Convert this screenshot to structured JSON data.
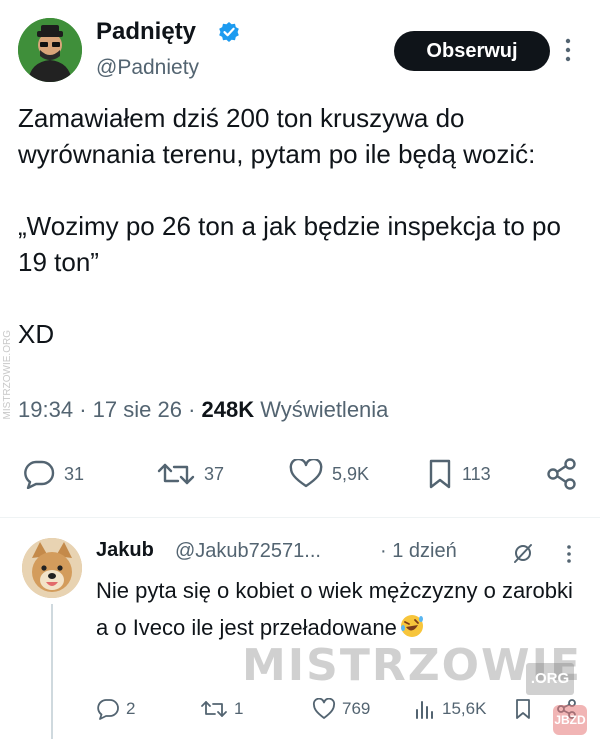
{
  "post": {
    "author_name": "Padnięty",
    "author_handle": "@Padniety",
    "follow_label": "Obserwuj",
    "text": "Zamawiałem dziś 200 ton kruszywa do wyrównania terenu, pytam po ile będą wozić:\n\n„Wozimy po 26 ton a jak będzie inspekcja to po 19 ton”\n\nXD",
    "time": "19:34",
    "date": "17 sie 26",
    "views_count": "248K",
    "views_label": "Wyświetlenia",
    "actions": {
      "replies": "31",
      "reposts": "37",
      "likes": "5,9K",
      "bookmarks": "113"
    }
  },
  "reply": {
    "author_name": "Jakub",
    "author_handle": "@Jakub72571...",
    "time": "· 1 dzień",
    "text": "Nie pyta się o kobiet o wiek mężczyzny o zarobki a o Iveco ile jest przeładowane",
    "actions": {
      "replies": "2",
      "reposts": "1",
      "likes": "769",
      "views": "15,6K"
    }
  },
  "watermark": {
    "text": "MISTRZOWIE",
    "suffix": ".ORG",
    "side_text": "MISTRZOWIE.ORG",
    "corner_text": "JBZD"
  },
  "colors": {
    "text_primary": "#0f1419",
    "text_secondary": "#536471",
    "verified_blue": "#1d9bf0",
    "button_dark": "#0f1419"
  }
}
